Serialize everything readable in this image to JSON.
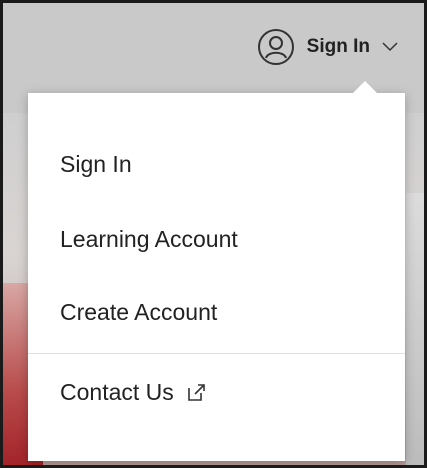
{
  "header": {
    "signin_label": "Sign In",
    "avatar_icon": "user-circle-icon",
    "chevron_icon": "chevron-down-icon"
  },
  "menu": {
    "items": [
      {
        "label": "Sign In"
      },
      {
        "label": "Learning Account"
      },
      {
        "label": "Create Account"
      },
      {
        "label": "Contact Us",
        "icon": "external-link-icon"
      }
    ]
  },
  "colors": {
    "text": "#222222",
    "menu_bg": "#ffffff",
    "header_bg": "#c9c9c9"
  }
}
